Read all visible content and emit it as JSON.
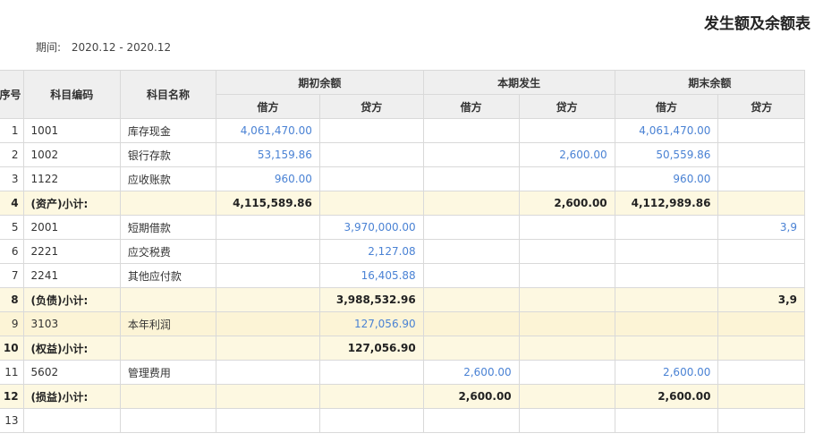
{
  "report": {
    "title": "发生额及余额表",
    "period_label": "期间:",
    "period_value": "2020.12 - 2020.12"
  },
  "table": {
    "headers": {
      "seq": "序号",
      "code": "科目编码",
      "name": "科目名称",
      "opening": "期初余额",
      "current": "本期发生",
      "closing": "期末余额",
      "debit": "借方",
      "credit": "贷方"
    },
    "rows": [
      {
        "seq": "1",
        "code": "1001",
        "name": "库存现金",
        "od": "4,061,470.00",
        "oc": "",
        "cd": "",
        "cc": "",
        "ed": "4,061,470.00",
        "ec": "",
        "type": "normal"
      },
      {
        "seq": "2",
        "code": "1002",
        "name": "银行存款",
        "od": "53,159.86",
        "oc": "",
        "cd": "",
        "cc": "2,600.00",
        "ed": "50,559.86",
        "ec": "",
        "type": "normal"
      },
      {
        "seq": "3",
        "code": "1122",
        "name": "应收账款",
        "od": "960.00",
        "oc": "",
        "cd": "",
        "cc": "",
        "ed": "960.00",
        "ec": "",
        "type": "normal"
      },
      {
        "seq": "4",
        "code": "(资产)小计:",
        "name": "",
        "od": "4,115,589.86",
        "oc": "",
        "cd": "",
        "cc": "2,600.00",
        "ed": "4,112,989.86",
        "ec": "",
        "type": "subtotal"
      },
      {
        "seq": "5",
        "code": "2001",
        "name": "短期借款",
        "od": "",
        "oc": "3,970,000.00",
        "cd": "",
        "cc": "",
        "ed": "",
        "ec": "3,9",
        "type": "normal"
      },
      {
        "seq": "6",
        "code": "2221",
        "name": "应交税费",
        "od": "",
        "oc": "2,127.08",
        "cd": "",
        "cc": "",
        "ed": "",
        "ec": "",
        "type": "normal"
      },
      {
        "seq": "7",
        "code": "2241",
        "name": "其他应付款",
        "od": "",
        "oc": "16,405.88",
        "cd": "",
        "cc": "",
        "ed": "",
        "ec": "",
        "type": "normal"
      },
      {
        "seq": "8",
        "code": "(负债)小计:",
        "name": "",
        "od": "",
        "oc": "3,988,532.96",
        "cd": "",
        "cc": "",
        "ed": "",
        "ec": "3,9",
        "type": "subtotal"
      },
      {
        "seq": "9",
        "code": "3103",
        "name": "本年利润",
        "od": "",
        "oc": "127,056.90",
        "cd": "",
        "cc": "",
        "ed": "",
        "ec": "",
        "type": "highlight"
      },
      {
        "seq": "10",
        "code": "(权益)小计:",
        "name": "",
        "od": "",
        "oc": "127,056.90",
        "cd": "",
        "cc": "",
        "ed": "",
        "ec": "",
        "type": "subtotal"
      },
      {
        "seq": "11",
        "code": "5602",
        "name": "管理费用",
        "od": "",
        "oc": "",
        "cd": "2,600.00",
        "cc": "",
        "ed": "2,600.00",
        "ec": "",
        "type": "normal"
      },
      {
        "seq": "12",
        "code": "(损益)小计:",
        "name": "",
        "od": "",
        "oc": "",
        "cd": "2,600.00",
        "cc": "",
        "ed": "2,600.00",
        "ec": "",
        "type": "subtotal"
      },
      {
        "seq": "13",
        "code": "",
        "name": "",
        "od": "",
        "oc": "",
        "cd": "",
        "cc": "",
        "ed": "",
        "ec": "",
        "type": "normal"
      }
    ]
  }
}
